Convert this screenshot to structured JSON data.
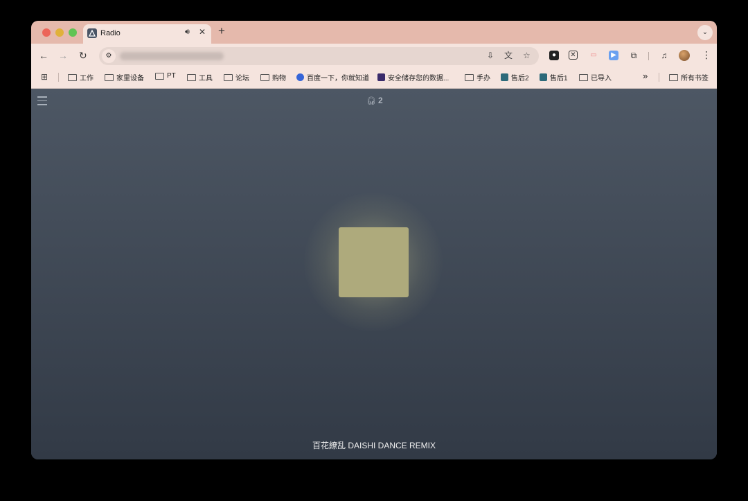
{
  "browser": {
    "tab": {
      "title": "Radio",
      "audio_icon": "speaker-icon",
      "close_label": "✕"
    },
    "new_tab_label": "+",
    "tab_menu_label": "⌄",
    "nav": {
      "back": "←",
      "forward": "→",
      "reload": "↻"
    },
    "omnibox_icons": [
      "install-icon",
      "translate-icon",
      "star-icon"
    ],
    "extensions": [
      "ext-icon-1",
      "ext-icon-2",
      "ext-icon-3",
      "ext-icon-4",
      "puzzle-icon"
    ],
    "media_icon": "media-control-icon",
    "kebab": "⋮"
  },
  "bookmarks": {
    "items": [
      {
        "label": "工作"
      },
      {
        "label": "家里设备"
      },
      {
        "label": "PT"
      },
      {
        "label": "工具"
      },
      {
        "label": "论坛"
      },
      {
        "label": "购物"
      },
      {
        "label": "百度一下，你就知道"
      },
      {
        "label": "安全储存您的数据..."
      },
      {
        "label": "手办"
      },
      {
        "label": "售后2"
      },
      {
        "label": "售后1"
      },
      {
        "label": "已导入"
      }
    ],
    "overflow_label": "»",
    "all_bookmarks": "所有书签"
  },
  "page": {
    "listener_count": "2",
    "song_title": "百花繚乱 DAISHI DANCE REMIX",
    "cover_color": "#aeaa7c"
  }
}
